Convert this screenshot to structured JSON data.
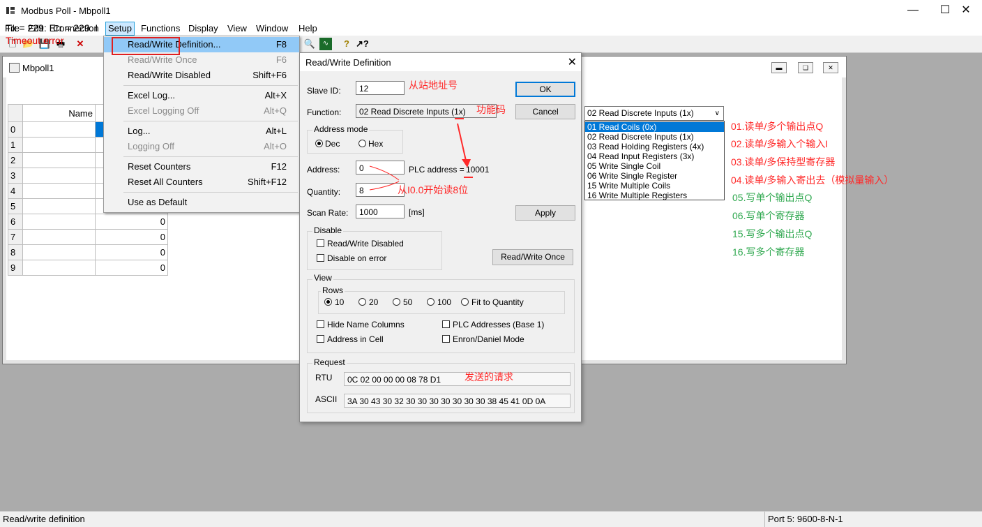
{
  "window": {
    "title": "Modbus Poll - Mbpoll1",
    "min": "—",
    "max": "☐",
    "close": "✕"
  },
  "menubar": [
    "File",
    "Edit",
    "Connection",
    "Setup",
    "Functions",
    "Display",
    "View",
    "Window",
    "Help"
  ],
  "child": {
    "title": "Mbpoll1",
    "status_line": "Tx = 229: Err = 229: I",
    "error": "Timeout error",
    "grid": {
      "header_name": "Name",
      "rows": [
        {
          "n": "0",
          "v": ""
        },
        {
          "n": "1",
          "v": ""
        },
        {
          "n": "2",
          "v": ""
        },
        {
          "n": "3",
          "v": ""
        },
        {
          "n": "4",
          "v": ""
        },
        {
          "n": "5",
          "v": ""
        },
        {
          "n": "6",
          "v": "0"
        },
        {
          "n": "7",
          "v": "0"
        },
        {
          "n": "8",
          "v": "0"
        },
        {
          "n": "9",
          "v": "0"
        }
      ]
    }
  },
  "setup_menu": [
    {
      "label": "Read/Write Definition...",
      "shortcut": "F8",
      "disabled": false
    },
    {
      "label": "Read/Write Once",
      "shortcut": "F6",
      "disabled": true
    },
    {
      "label": "Read/Write Disabled",
      "shortcut": "Shift+F6",
      "disabled": false
    },
    {
      "label": "Excel Log...",
      "shortcut": "Alt+X",
      "disabled": false
    },
    {
      "label": "Excel Logging Off",
      "shortcut": "Alt+Q",
      "disabled": true
    },
    {
      "label": "Log...",
      "shortcut": "Alt+L",
      "disabled": false
    },
    {
      "label": "Logging Off",
      "shortcut": "Alt+O",
      "disabled": true
    },
    {
      "label": "Reset Counters",
      "shortcut": "F12",
      "disabled": false
    },
    {
      "label": "Reset All Counters",
      "shortcut": "Shift+F12",
      "disabled": false
    },
    {
      "label": "Use as Default",
      "shortcut": "",
      "disabled": false
    }
  ],
  "dialog": {
    "title": "Read/Write Definition",
    "slave_id_label": "Slave ID:",
    "slave_id": "12",
    "function_label": "Function:",
    "function_value": "02 Read Discrete Inputs (1x)",
    "address_mode_label": "Address mode",
    "dec": "Dec",
    "hex": "Hex",
    "address_label": "Address:",
    "address": "0",
    "plc_address_label": "PLC address =",
    "plc_address": "10001",
    "quantity_label": "Quantity:",
    "quantity": "8",
    "scan_rate_label": "Scan Rate:",
    "scan_rate": "1000",
    "scan_rate_unit": "[ms]",
    "ok": "OK",
    "cancel": "Cancel",
    "apply": "Apply",
    "disable_label": "Disable",
    "rw_disabled": "Read/Write Disabled",
    "disable_on_error": "Disable on error",
    "rw_once": "Read/Write Once",
    "view_label": "View",
    "rows_label": "Rows",
    "rows_options": [
      "10",
      "20",
      "50",
      "100",
      "Fit to Quantity"
    ],
    "hide_name_columns": "Hide Name Columns",
    "plc_addresses": "PLC Addresses (Base 1)",
    "address_in_cell": "Address in Cell",
    "enron_mode": "Enron/Daniel Mode",
    "request_label": "Request",
    "rtu_label": "RTU",
    "rtu": "0C 02 00 00 00 08 78 D1",
    "ascii_label": "ASCII",
    "ascii": "3A 30 43 30 32 30 30 30 30 30 30 30 38 45 41 0D 0A"
  },
  "function_dropdown": {
    "selected": "02 Read Discrete Inputs (1x)",
    "options": [
      "01 Read Coils (0x)",
      "02 Read Discrete Inputs (1x)",
      "03 Read Holding Registers (4x)",
      "04 Read Input Registers (3x)",
      "05 Write Single Coil",
      "06 Write Single Register",
      "15 Write Multiple Coils",
      "16 Write Multiple Registers"
    ]
  },
  "annotations": {
    "slave": "从站地址号",
    "func": "功能码",
    "start": "从I0.0开始读8位",
    "request": "发送的请求",
    "fc01": "01.读单/多个输出点Q",
    "fc02": "02.读单/多输入个输入I",
    "fc03": "03.读单/多保持型寄存器",
    "fc04": "04.读单/多输入寄出去（模拟量输入）",
    "fc05": "05.写单个输出点Q",
    "fc06": "06.写单个寄存器",
    "fc15": "15.写多个输出点Q",
    "fc16": "16.写多个寄存器"
  },
  "statusbar": {
    "left": "Read/write definition",
    "right": "Port 5: 9600-8-N-1"
  }
}
